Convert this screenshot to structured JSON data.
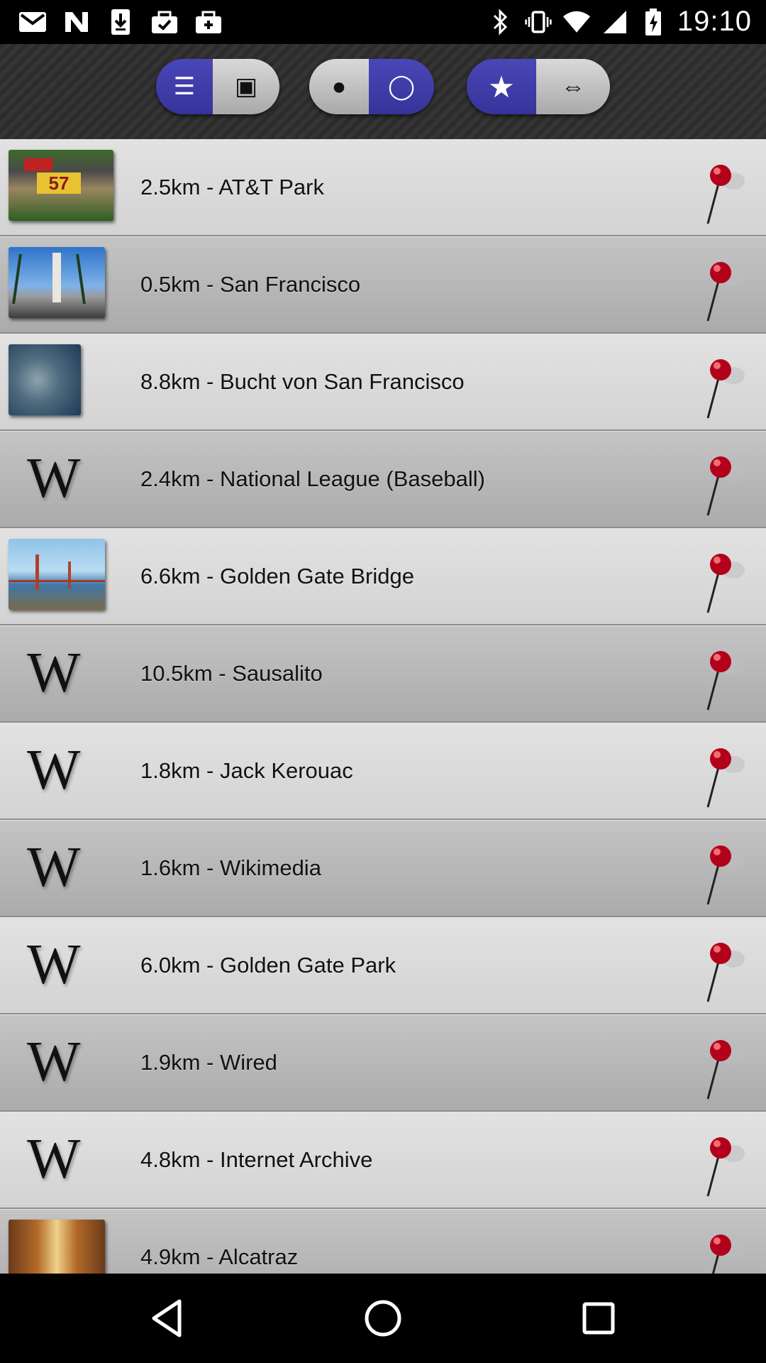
{
  "status_bar": {
    "time": "19:10",
    "left_icons": [
      "gmail-icon",
      "n-app-icon",
      "download-icon",
      "clipboard-check-icon",
      "briefcase-icon"
    ],
    "right_icons": [
      "bluetooth-icon",
      "vibrate-icon",
      "wifi-icon",
      "cell-signal-icon",
      "battery-icon"
    ]
  },
  "toolbar": {
    "group1": {
      "list_label": "☰",
      "map_label": "▣"
    },
    "group2": {
      "filled_label": "●",
      "empty_label": "◯"
    },
    "group3": {
      "star_label": "★",
      "arrows_label": "⇔"
    }
  },
  "places": [
    {
      "label": "2.5km - AT&T Park",
      "thumb": "att-park"
    },
    {
      "label": "0.5km - San Francisco",
      "thumb": "ferry-building"
    },
    {
      "label": "8.8km - Bucht von San Francisco",
      "thumb": "bay-aerial"
    },
    {
      "label": "2.4km - National League (Baseball)",
      "thumb": "wikipedia"
    },
    {
      "label": "6.6km - Golden Gate Bridge",
      "thumb": "golden-gate"
    },
    {
      "label": "10.5km - Sausalito",
      "thumb": "wikipedia"
    },
    {
      "label": "1.8km - Jack Kerouac",
      "thumb": "wikipedia"
    },
    {
      "label": "1.6km - Wikimedia",
      "thumb": "wikipedia"
    },
    {
      "label": "6.0km - Golden Gate Park",
      "thumb": "wikipedia"
    },
    {
      "label": "1.9km - Wired",
      "thumb": "wikipedia"
    },
    {
      "label": "4.8km - Internet Archive",
      "thumb": "wikipedia"
    },
    {
      "label": "4.9km - Alcatraz",
      "thumb": "alcatraz"
    }
  ],
  "wiki_glyph": "W",
  "score_digits": "57",
  "colors": {
    "accent_blue": "#3d3aa8",
    "pin_red": "#b3001b"
  },
  "navbar": {
    "icons": [
      "back-icon",
      "home-icon",
      "recents-icon"
    ]
  }
}
